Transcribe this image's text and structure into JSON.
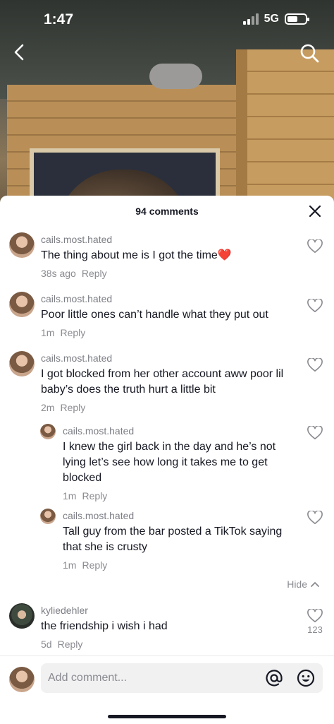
{
  "status_bar": {
    "time": "1:47",
    "network": "5G",
    "battery_level": 0.6
  },
  "nav": {
    "back_icon": "chevron-left-icon",
    "search_icon": "search-icon"
  },
  "sheet": {
    "title": "94 comments",
    "close_icon": "close-icon"
  },
  "comments": [
    {
      "user": "cails.most.hated",
      "text": "The thing about me is I got the time❤️",
      "time": "38s ago",
      "reply": "Reply"
    },
    {
      "user": "cails.most.hated",
      "text": "Poor little ones can’t handle what they put out",
      "time": "1m",
      "reply": "Reply"
    },
    {
      "user": "cails.most.hated",
      "text": "I got blocked from her other account aww poor lil baby’s does the truth hurt a little bit",
      "time": "2m",
      "reply": "Reply",
      "replies": [
        {
          "user": "cails.most.hated",
          "text": "I knew the girl back in the day and he’s not lying let’s see how long it takes me to get blocked",
          "time": "1m",
          "reply": "Reply"
        },
        {
          "user": "cails.most.hated",
          "text": "Tall guy from the bar posted a TikTok saying that she is crusty",
          "time": "1m",
          "reply": "Reply"
        }
      ],
      "hide_label": "Hide"
    },
    {
      "user": "kyliedehler",
      "text": "the friendship i wish i had",
      "time": "5d",
      "reply": "Reply",
      "likes": "123"
    }
  ],
  "composer": {
    "placeholder": "Add comment...",
    "mention_icon": "at-icon",
    "emoji_icon": "emoji-icon"
  }
}
